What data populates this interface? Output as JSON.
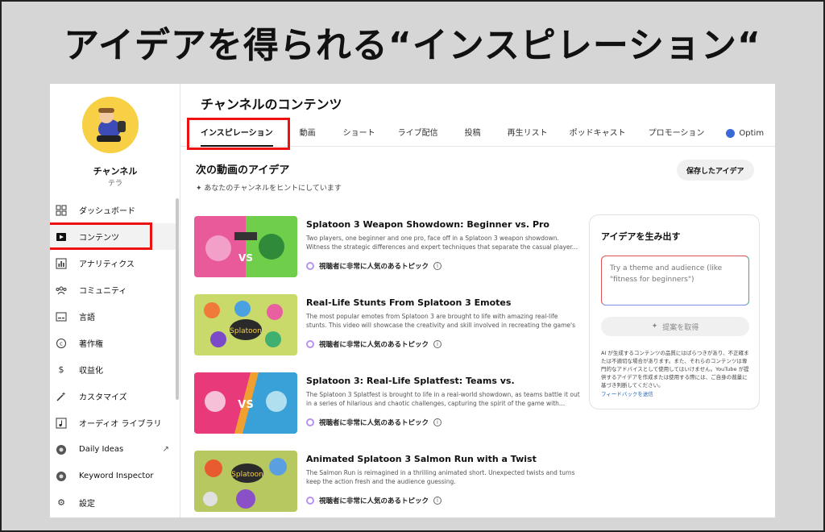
{
  "headline": "アイデアを得られる“インスピレーション“",
  "channel": {
    "name": "チャンネル",
    "handle": "テラ"
  },
  "sidebar": {
    "items": [
      {
        "label": "ダッシュボード",
        "icon": "dashboard-icon"
      },
      {
        "label": "コンテンツ",
        "icon": "content-icon"
      },
      {
        "label": "アナリティクス",
        "icon": "analytics-icon"
      },
      {
        "label": "コミュニティ",
        "icon": "community-icon"
      },
      {
        "label": "言語",
        "icon": "subtitles-icon"
      },
      {
        "label": "著作権",
        "icon": "copyright-icon"
      },
      {
        "label": "収益化",
        "icon": "dollar-icon"
      },
      {
        "label": "カスタマイズ",
        "icon": "magic-wand-icon"
      },
      {
        "label": "オーディオ ライブラリ",
        "icon": "audio-library-icon"
      },
      {
        "label": "Daily Ideas",
        "icon": "extension-icon"
      },
      {
        "label": "Keyword Inspector",
        "icon": "extension-icon"
      },
      {
        "label": "設定",
        "icon": "gear-icon"
      }
    ]
  },
  "main": {
    "title": "チャンネルのコンテンツ",
    "tabs": [
      "インスピレーション",
      "動画",
      "ショート",
      "ライブ配信",
      "投稿",
      "再生リスト",
      "ポッドキャスト",
      "プロモーション",
      "Optim"
    ],
    "section_title": "次の動画のアイデア",
    "section_sub": "あなたのチャンネルをヒントにしています",
    "saved_button": "保存したアイデア",
    "topic_label": "視聴者に非常に人気のあるトピック",
    "ideas": [
      {
        "title": "Splatoon 3 Weapon Showdown: Beginner vs. Pro",
        "desc": "Two players, one beginner and one pro, face off in a Splatoon 3 weapon showdown. Witness the strategic differences and expert techniques that separate the casual player..."
      },
      {
        "title": "Real-Life Stunts From Splatoon 3 Emotes",
        "desc": "The most popular emotes from Splatoon 3 are brought to life with amazing real-life stunts. This video will showcase the creativity and skill involved in recreating the game's iconic..."
      },
      {
        "title": "Splatoon 3: Real-Life Splatfest: Teams vs.",
        "desc": "The Splatoon 3 Splatfest is brought to life in a real-world showdown, as teams battle it out in a series of hilarious and chaotic challenges, capturing the spirit of the game with..."
      },
      {
        "title": "Animated Splatoon 3 Salmon Run with a Twist",
        "desc": "The Salmon Run is reimagined in a thrilling animated short. Unexpected twists and turns keep the action fresh and the audience guessing."
      }
    ]
  },
  "panel": {
    "title": "アイデアを生み出す",
    "placeholder": "Try a theme and audience (like \"fitness for beginners\")",
    "button": "提案を取得",
    "note": "AI が生成するコンテンツの品質にはばらつきがあり、不正確または不適切な場合があります。また、それらのコンテンツは専門的なアドバイスとして使用してはいけません。YouTube が提供するアイデアを作成または使用する際には、ご自身の裁量に基づき判断してください。",
    "link": "フィードバックを送信"
  },
  "colors": {
    "highlight": "#ee1111",
    "avatar_bg": "#f7d046",
    "topic_ring": "#b993f0"
  }
}
